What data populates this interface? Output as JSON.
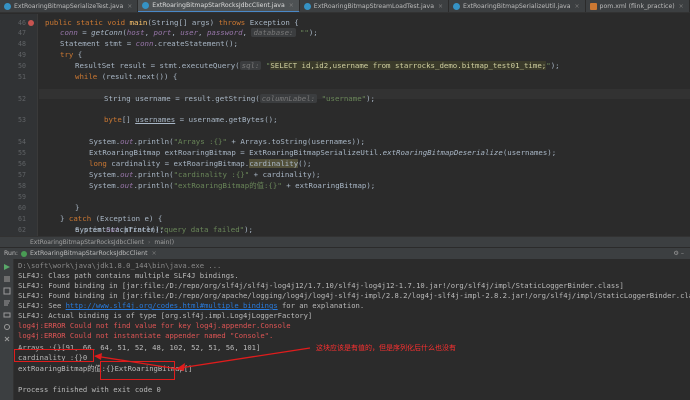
{
  "tabs": [
    {
      "label": "ExtRoaringBitmapSerializeTest.java",
      "type": "java",
      "active": false
    },
    {
      "label": "ExtRoaringBitmapStarRocksJdbcClient.java",
      "type": "java",
      "active": true
    },
    {
      "label": "ExtRoaringBitmapStreamLoadTest.java",
      "type": "java",
      "active": false
    },
    {
      "label": "ExtRoaringBitmapSerializeUtil.java",
      "type": "java",
      "active": false
    },
    {
      "label": "pom.xml (flink_practice)",
      "type": "xml",
      "active": false
    }
  ],
  "editor": {
    "line_numbers": [
      "46",
      "47",
      "48",
      "49",
      "50",
      "51",
      "",
      "52",
      "",
      "53",
      "",
      "54",
      "55",
      "56",
      "57",
      "58",
      "59",
      "60",
      "",
      "61",
      "62",
      "63",
      "64"
    ],
    "lines": {
      "l46": {
        "kw1": "public static void ",
        "fn": "main",
        "rest1": "(String[] args) ",
        "kw2": "throws ",
        "rest2": "Exception {"
      },
      "l47": {
        "fld": "conn",
        "rest1": " = ",
        "fn": "getConn",
        "rest2": "(",
        "a1": "host",
        "c1": ", ",
        "a2": "port",
        "c2": ", ",
        "a3": "user",
        "c3": ", ",
        "a4": "password",
        "c4": ", ",
        "hint": "database:",
        "str": "\"\"",
        "end": ");"
      },
      "l48": {
        "text": "Statement stmt = ",
        "fld": "conn",
        "end": ".createStatement();"
      },
      "l49": {
        "kw": "try",
        "end": " {"
      },
      "l50": {
        "text": "ResultSet result = stmt.executeQuery(",
        "hint": "sql:",
        "str1": "\"",
        "sql": "SELECT id,id2,username from starrocks_demo.bitmap_test01_time;",
        "str2": "\"",
        "end": ");"
      },
      "l51": {
        "kw": "while",
        "end": " (result.next()) {"
      },
      "l52": {
        "text": "String username = result.getString(",
        "hint": "columnLabel:",
        "str": "\"username\"",
        "end": ");"
      },
      "l53": {
        "kw": "byte",
        "text1": "[] ",
        "under": "usernames",
        "end": " = username.getBytes();"
      },
      "l54": {
        "t1": "System.",
        "out": "out",
        "t2": ".println(",
        "str": "\"Arrays :{}\"",
        "end": " + Arrays.toString(usernames));"
      },
      "l55": {
        "text": "ExtRoaringBitmap extRoaringBitmap = ExtRoaringBitmapSerializeUtil.",
        "ital": "extRoaringBitmapDeserialize",
        "end": "(usernames);"
      },
      "l56": {
        "kw": "long",
        "text": " cardinality = extRoaringBitmap.",
        "hl": "cardinality",
        "end": "();"
      },
      "l57": {
        "t1": "System.",
        "out": "out",
        "t2": ".println(",
        "str": "\"cardinality :{}\"",
        "end": " + cardinality);"
      },
      "l58": {
        "t1": "System.",
        "out": "out",
        "t2": ".println(",
        "str": "\"extRoaringBitmap的值:{}\"",
        "end": " + extRoaringBitmap);"
      },
      "l60": {
        "text": "}"
      },
      "l61": {
        "t1": "} ",
        "kw": "catch",
        "end": " (Exception e) {"
      },
      "l62": {
        "t1": "System.",
        "out": "out",
        "t2": ".println(",
        "str": "\"query data failed\"",
        "end": ");"
      },
      "l63": {
        "text": "e.printStackTrace();"
      },
      "l64": {
        "text": "}"
      }
    }
  },
  "breadcrumb": [
    "ExtRoaringBitmapStarRocksJdbcClient",
    "main()"
  ],
  "run": {
    "label": "Run:",
    "tab": "ExtRoaringBitmapStarRocksJdbcClient",
    "close": "×"
  },
  "console": [
    {
      "text": "D:\\soft\\work\\java\\jdk1.8.0_144\\bin\\java.exe ...",
      "kind": "gray"
    },
    {
      "text": "SLF4J: Class path contains multiple SLF4J bindings.",
      "kind": "normal"
    },
    {
      "text": "SLF4J: Found binding in [jar:file:/D:/repo/org/slf4j/slf4j-log4j12/1.7.10/slf4j-log4j12-1.7.10.jar!/org/slf4j/impl/StaticLoggerBinder.class]",
      "kind": "normal"
    },
    {
      "text": "SLF4J: Found binding in [jar:file:/D:/repo/org/apache/logging/log4j/log4j-slf4j-impl/2.8.2/log4j-slf4j-impl-2.8.2.jar!/org/slf4j/impl/StaticLoggerBinder.class]",
      "kind": "normal"
    },
    {
      "text_pre": "SLF4J: See ",
      "link": "http://www.slf4j.org/codes.html#multiple_bindings",
      "text_post": " for an explanation.",
      "kind": "link"
    },
    {
      "text": "SLF4J: Actual binding is of type [org.slf4j.impl.Log4jLoggerFactory]",
      "kind": "normal"
    },
    {
      "text": "log4j:ERROR Could not find value for key log4j.appender.Console",
      "kind": "err"
    },
    {
      "text": "log4j:ERROR Could not instantiate appender named \"Console\".",
      "kind": "err"
    },
    {
      "text": "Arrays :{}[91, 66, 64, 51, 52, 48, 102, 52, 51, 56, 101]",
      "kind": "normal"
    },
    {
      "text": "cardinality :{}0",
      "kind": "normal"
    },
    {
      "text": "extRoaringBitmap的值:{}ExtRoaringBitmap[]",
      "kind": "normal"
    },
    {
      "text": "",
      "kind": "normal"
    },
    {
      "text": "Process finished with exit code 0",
      "kind": "normal"
    }
  ],
  "annotation": {
    "text": "这块应该是有值的，但是序列化后什么也没有",
    "color": "#e01c1c"
  },
  "colors": {
    "keyword": "#cc7832",
    "string": "#6a8759",
    "function": "#ffc66d",
    "field": "#9876aa",
    "error": "#e05555",
    "background": "#2b2b2b"
  }
}
